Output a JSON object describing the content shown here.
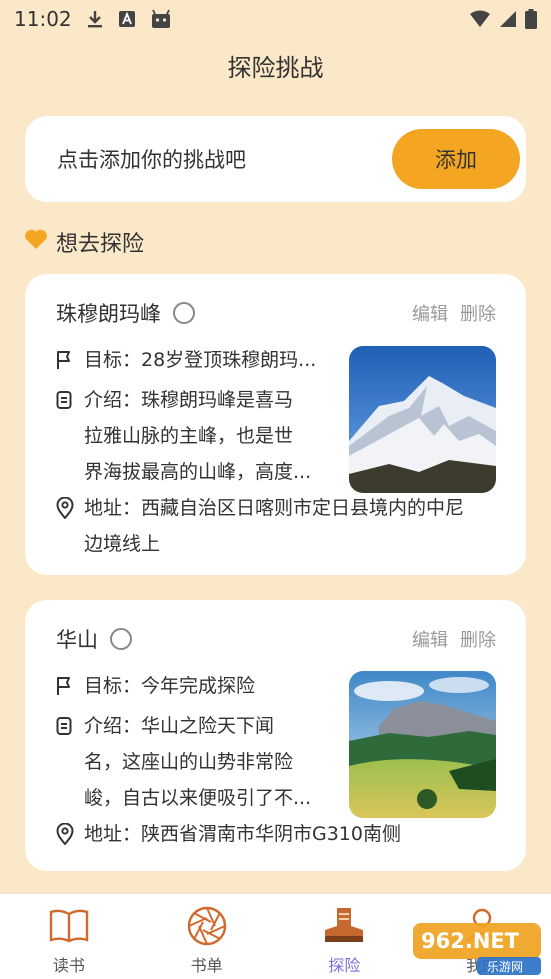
{
  "status_bar": {
    "time": "11:02"
  },
  "header": {
    "title": "探险挑战"
  },
  "add_challenge": {
    "prompt": "点击添加你的挑战吧",
    "button_label": "添加"
  },
  "section": {
    "title": "想去探险"
  },
  "cards": [
    {
      "title": "珠穆朗玛峰",
      "edit_label": "编辑",
      "delete_label": "删除",
      "goal": "目标：28岁登顶珠穆朗玛...",
      "intro_lines": [
        "介绍：珠穆朗玛峰是喜马",
        "拉雅山脉的主峰，也是世",
        "界海拔最高的山峰，高度..."
      ],
      "address_lines": [
        "地址：西藏自治区日喀则市定日县境内的中尼",
        "边境线上"
      ]
    },
    {
      "title": "华山",
      "edit_label": "编辑",
      "delete_label": "删除",
      "goal": "目标：今年完成探险",
      "intro_lines": [
        "介绍：华山之险天下闻",
        "名，这座山的山势非常险",
        "峻，自古以来便吸引了不..."
      ],
      "address_lines": [
        "地址：陕西省渭南市华阴市G310南侧"
      ]
    }
  ],
  "bottom_nav": {
    "items": [
      {
        "label": "读书",
        "icon": "book-icon",
        "active": false
      },
      {
        "label": "书单",
        "icon": "aperture-icon",
        "active": false
      },
      {
        "label": "探险",
        "icon": "boot-icon",
        "active": true
      },
      {
        "label": "我的",
        "icon": "profile-icon",
        "active": false
      }
    ]
  },
  "watermark": {
    "text": "962.NET",
    "subtext": "乐游网"
  },
  "colors": {
    "background": "#fae8c8",
    "accent": "#f4a623",
    "active_nav": "#7b6fd6"
  }
}
